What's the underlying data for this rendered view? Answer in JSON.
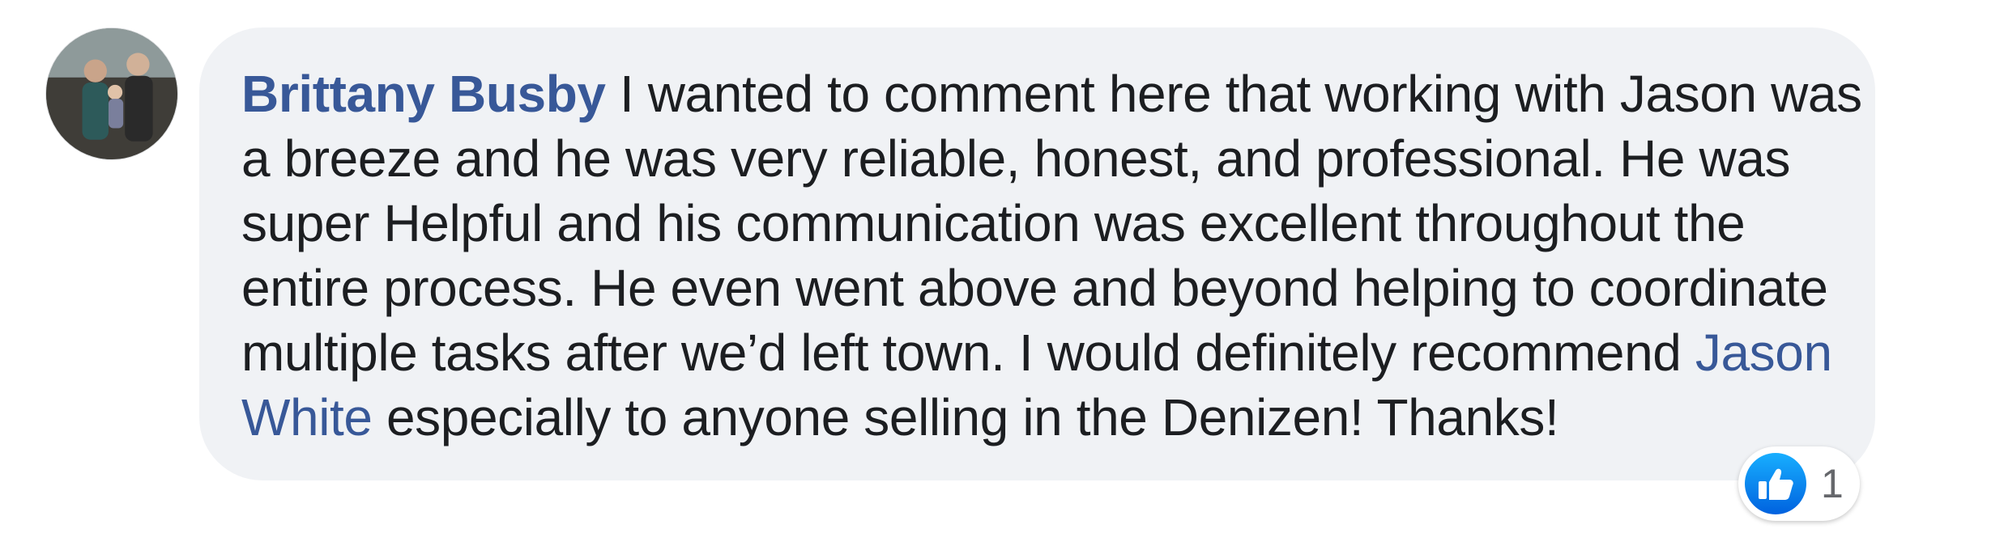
{
  "comment": {
    "author": "Brittany Busby",
    "text_lines": [
      " I wanted to comment here that working with Jason was",
      "a breeze and he was very reliable, honest, and professional. He was",
      "super Helpful and his communication was excellent throughout the",
      "entire process. He even went above and beyond helping to coordinate",
      "multiple tasks after we’d left town. I would definitely recommend "
    ],
    "mention_first": "Jason",
    "mention_second": "White",
    "text_end": " especially to anyone selling in the Denizen! Thanks!"
  },
  "reactions": {
    "icon": "like-thumbs-up-icon",
    "count": "1"
  },
  "colors": {
    "bubble_bg": "#f0f2f5",
    "author_link": "#385898",
    "text": "#1c1e21",
    "like_blue": "#1877f2"
  }
}
